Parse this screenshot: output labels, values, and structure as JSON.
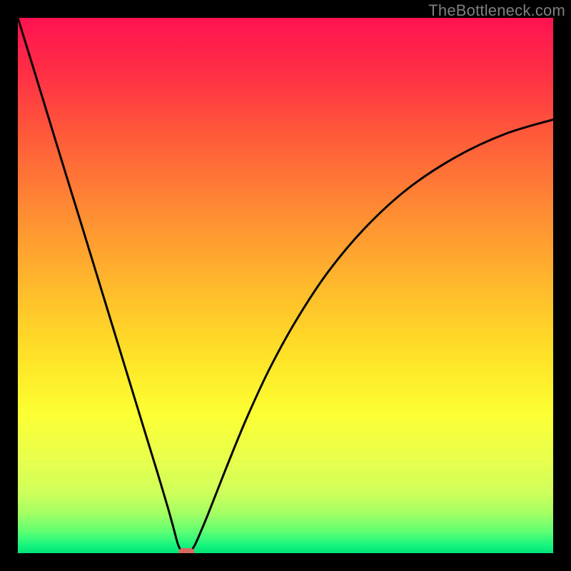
{
  "watermark": "TheBottleneck.com",
  "chart_data": {
    "type": "line",
    "title": "",
    "xlabel": "",
    "ylabel": "",
    "xlim": [
      0,
      100
    ],
    "ylim": [
      0,
      100
    ],
    "series": [
      {
        "name": "curve",
        "x": [
          0,
          3,
          6,
          9,
          12,
          15,
          18,
          21,
          24,
          26,
          28,
          29,
          30,
          30.8,
          31.5,
          32.2,
          33,
          34,
          35.5,
          37.5,
          40,
          43,
          47,
          52,
          58,
          65,
          73,
          82,
          91,
          100
        ],
        "y": [
          100,
          90.3,
          80.5,
          70.7,
          61.0,
          51.2,
          41.4,
          31.6,
          21.8,
          15.3,
          8.6,
          5.0,
          1.4,
          0.3,
          0.0,
          0.3,
          1.4,
          3.6,
          7.2,
          12.3,
          18.6,
          25.8,
          34.4,
          43.5,
          52.6,
          60.9,
          68.2,
          74.1,
          78.3,
          81.0
        ]
      }
    ],
    "marker": {
      "x": 31.5,
      "y": 0.0
    },
    "gradient_stops": [
      {
        "offset": 0.0,
        "color": "#ff1250"
      },
      {
        "offset": 0.1,
        "color": "#ff2e45"
      },
      {
        "offset": 0.22,
        "color": "#ff5a3a"
      },
      {
        "offset": 0.36,
        "color": "#ff8b33"
      },
      {
        "offset": 0.5,
        "color": "#ffb92c"
      },
      {
        "offset": 0.63,
        "color": "#ffe227"
      },
      {
        "offset": 0.74,
        "color": "#fcff33"
      },
      {
        "offset": 0.83,
        "color": "#e6ff4e"
      },
      {
        "offset": 0.885,
        "color": "#d0ff5a"
      },
      {
        "offset": 0.925,
        "color": "#a4ff63"
      },
      {
        "offset": 0.958,
        "color": "#63ff72"
      },
      {
        "offset": 0.985,
        "color": "#18f57e"
      },
      {
        "offset": 1.0,
        "color": "#00e37a"
      }
    ],
    "marker_color": "#d86a62"
  }
}
